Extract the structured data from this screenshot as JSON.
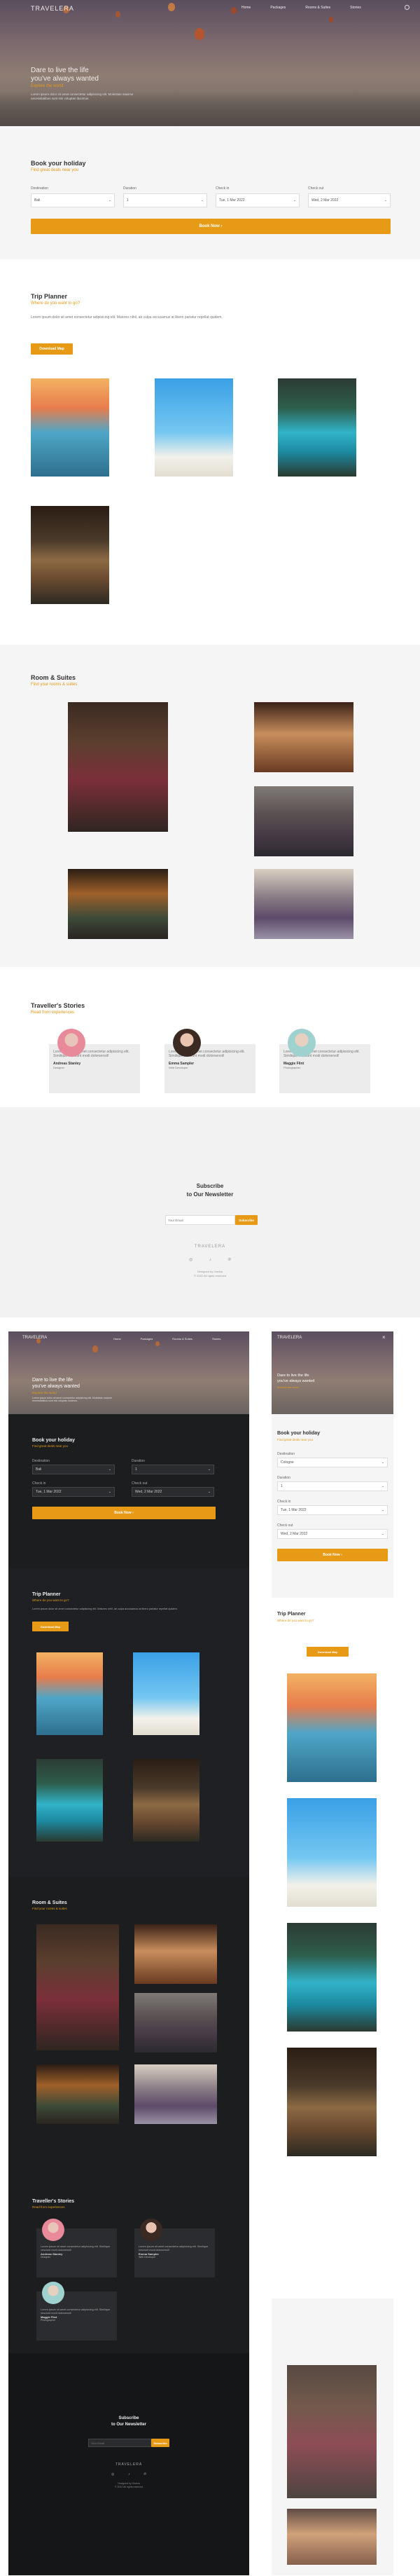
{
  "brand": "TRAVELERA",
  "nav": {
    "items": [
      "Home",
      "Packages",
      "Rooms & Suites",
      "Stories"
    ]
  },
  "hero": {
    "line1": "Dare to live the life",
    "line2": "you've always wanted",
    "tagline": "Explore the world",
    "body": "Lorem ipsum dolor sit amet consectetur adipisicing elit. Molestias maxime necessitatibus sunt nisi voluptas ducimus."
  },
  "booking": {
    "title": "Book your holiday",
    "subtitle": "Find great deals near you",
    "destination_label": "Destination",
    "destination_value": "Bali",
    "destination_value_mobile": "Cologne",
    "duration_label": "Duration",
    "duration_value": "1",
    "checkin_label": "Check in",
    "checkin_value": "Tue, 1 Mar 2022",
    "checkout_label": "Check out",
    "checkout_value": "Wed, 2 Mar 2022",
    "button": "Book Now"
  },
  "planner": {
    "title": "Trip Planner",
    "subtitle": "Where do you want to go?",
    "body": "Lorem ipsum dolor sit amet consectetur adipisicing elit. Maiores nihil, ab culpa accusamus at libero pariatur repellat quidem.",
    "button": "Download Map"
  },
  "rooms": {
    "title": "Room & Suites",
    "subtitle": "Find your rooms & suites"
  },
  "stories": {
    "title": "Traveller's Stories",
    "subtitle": "Read from experiences",
    "cards": [
      {
        "text": "Lorem ipsum sit amet consectetur adipisicing elit. Similique nesciunt modi dolorsensit!",
        "name": "Andreas Stanley",
        "role": "Designer"
      },
      {
        "text": "Lorem ipsum sit amet consectetur adipisicing elit. Similique nesciunt modi dolorsensit!",
        "name": "Emma Sampler",
        "role": "Web Devoloper"
      },
      {
        "text": "Lorem ipsum sit amet consectetur adipisicing elit. Similique nesciunt modi dolorsensit!",
        "name": "Maggie Flint",
        "role": "Photographer"
      }
    ]
  },
  "newsletter": {
    "line1": "Subscribe",
    "line2": "to Our Newsletter",
    "placeholder": "Your Email",
    "button": "Subscribe",
    "footer_brand": "TRAVELERA",
    "credit1": "Designed by Geelva",
    "credit2": "© 2022 All rights reserved"
  },
  "colors": {
    "accent": "#e69a16",
    "dark": "#1c1d1f",
    "light_bg": "#f5f5f5"
  }
}
